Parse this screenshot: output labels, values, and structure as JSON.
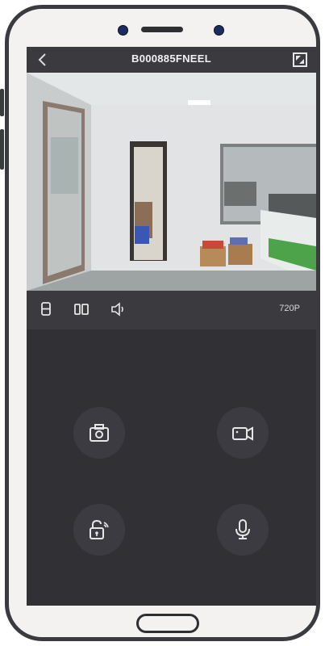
{
  "header": {
    "title": "B000885FNEEL"
  },
  "icons": {
    "back": "chevron-left-icon",
    "fullscreen": "fullscreen-icon",
    "layout_single": "single-view-icon",
    "layout_split": "split-view-icon",
    "sound": "speaker-icon",
    "snapshot": "camera-icon",
    "record": "video-record-icon",
    "unlock": "remote-unlock-icon",
    "talk": "microphone-icon"
  },
  "toolbar": {
    "resolution": "720P"
  },
  "colors": {
    "screen_bg": "#303035",
    "bar_bg": "#3a3a3f",
    "button_bg": "#3b3b41",
    "icon": "#e6e6e6"
  }
}
